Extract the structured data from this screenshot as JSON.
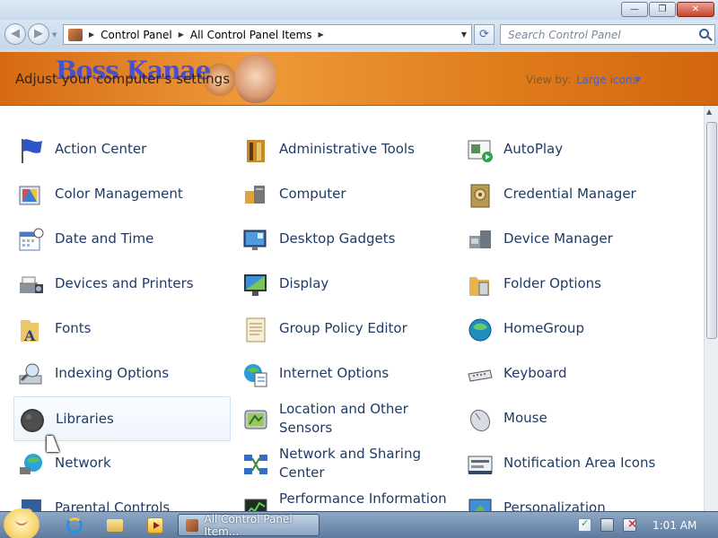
{
  "window": {
    "minimize_glyph": "—",
    "maximize_glyph": "❐",
    "close_glyph": "✕"
  },
  "navigation": {
    "back_glyph": "◀",
    "forward_glyph": "▶",
    "dropdown_glyph": "▼",
    "address": {
      "separator_glyph": "▶",
      "segments": [
        "Control Panel",
        "All Control Panel Items"
      ],
      "dropdown_glyph": "▼"
    },
    "refresh_glyph": "⟳",
    "search_placeholder": "Search Control Panel"
  },
  "banner": {
    "logo_text": "Boss Kanae",
    "title": "Adjust your computer's settings",
    "view_by_label": "View by:",
    "view_by_value": "Large icons",
    "view_by_arrow": "▼"
  },
  "items": [
    {
      "label": "Action Center",
      "icon": "action-center-icon"
    },
    {
      "label": "Administrative Tools",
      "icon": "administrative-tools-icon"
    },
    {
      "label": "AutoPlay",
      "icon": "autoplay-icon"
    },
    {
      "label": "Color Management",
      "icon": "color-management-icon"
    },
    {
      "label": "Computer",
      "icon": "computer-icon"
    },
    {
      "label": "Credential Manager",
      "icon": "credential-manager-icon"
    },
    {
      "label": "Date and Time",
      "icon": "date-and-time-icon"
    },
    {
      "label": "Desktop Gadgets",
      "icon": "desktop-gadgets-icon"
    },
    {
      "label": "Device Manager",
      "icon": "device-manager-icon"
    },
    {
      "label": "Devices and Printers",
      "icon": "devices-and-printers-icon"
    },
    {
      "label": "Display",
      "icon": "display-icon"
    },
    {
      "label": "Folder Options",
      "icon": "folder-options-icon"
    },
    {
      "label": "Fonts",
      "icon": "fonts-icon"
    },
    {
      "label": "Group Policy Editor",
      "icon": "group-policy-editor-icon"
    },
    {
      "label": "HomeGroup",
      "icon": "homegroup-icon"
    },
    {
      "label": "Indexing Options",
      "icon": "indexing-options-icon"
    },
    {
      "label": "Internet Options",
      "icon": "internet-options-icon"
    },
    {
      "label": "Keyboard",
      "icon": "keyboard-icon"
    },
    {
      "label": "Libraries",
      "icon": "libraries-icon"
    },
    {
      "label": "Location and Other Sensors",
      "icon": "location-sensors-icon"
    },
    {
      "label": "Mouse",
      "icon": "mouse-icon"
    },
    {
      "label": "Network",
      "icon": "network-icon"
    },
    {
      "label": "Network and Sharing Center",
      "icon": "network-sharing-center-icon"
    },
    {
      "label": "Notification Area Icons",
      "icon": "notification-area-icons-icon"
    },
    {
      "label": "Parental Controls",
      "icon": "parental-controls-icon"
    },
    {
      "label": "Performance Information and Tools",
      "icon": "performance-information-icon"
    },
    {
      "label": "Personalization",
      "icon": "personalization-icon"
    }
  ],
  "scrollbar": {
    "up_glyph": "▲"
  },
  "taskbar": {
    "task_label": "All Control Panel Item...",
    "clock": "1:01 AM",
    "tray_icons": [
      "action-center-flag-icon",
      "network-status-icon",
      "volume-muted-icon"
    ]
  }
}
